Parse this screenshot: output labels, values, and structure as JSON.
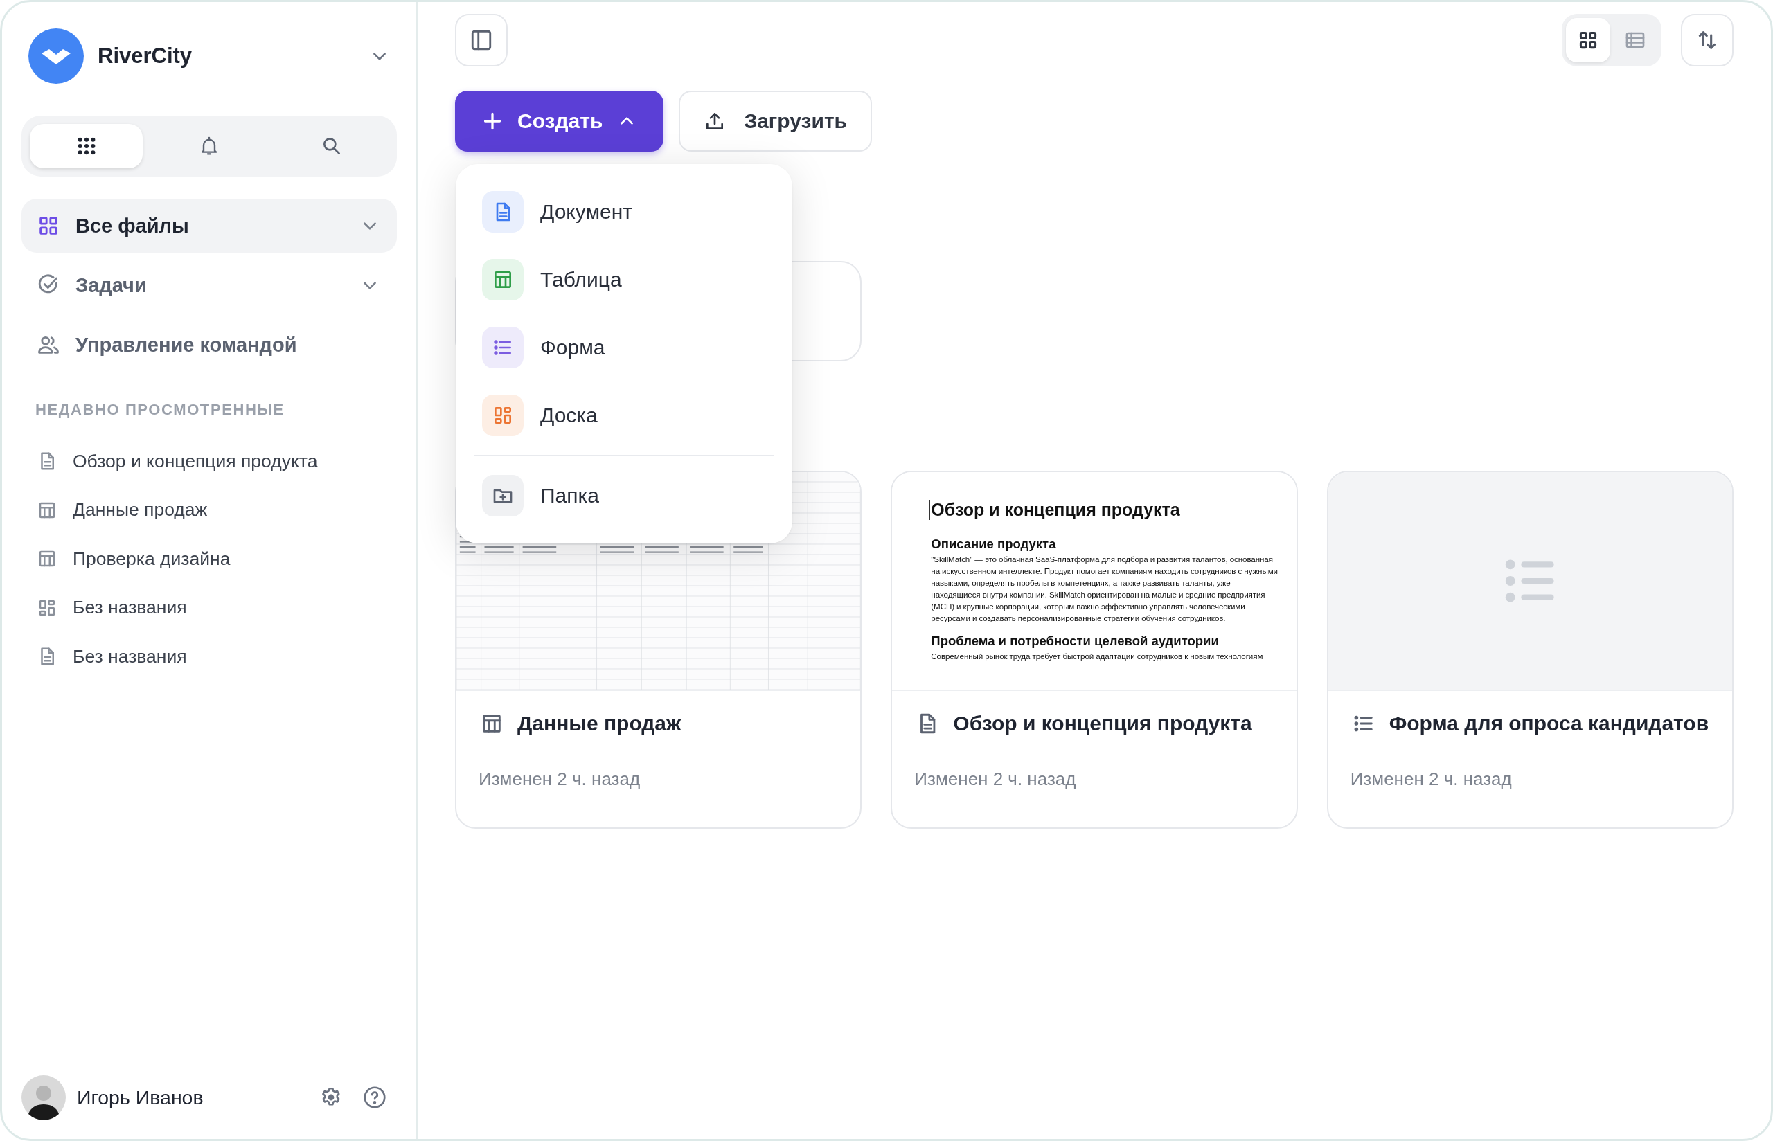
{
  "workspace": {
    "name": "RiverCity"
  },
  "sidebar_tabs": [
    {
      "kind": "apps",
      "selected": true
    },
    {
      "kind": "notifications",
      "selected": false
    },
    {
      "kind": "search",
      "selected": false
    }
  ],
  "nav": [
    {
      "label": "Все файлы",
      "kind": "files",
      "selected": true,
      "expandable": true
    },
    {
      "label": "Задачи",
      "kind": "tasks",
      "selected": false,
      "expandable": true
    },
    {
      "label": "Управление командой",
      "kind": "team",
      "selected": false,
      "expandable": false
    }
  ],
  "recent": {
    "title": "НЕДАВНО ПРОСМОТРЕННЫЕ",
    "items": [
      {
        "label": "Обзор и концепция продукта",
        "kind": "document"
      },
      {
        "label": "Данные продаж",
        "kind": "table"
      },
      {
        "label": "Проверка дизайна",
        "kind": "table"
      },
      {
        "label": "Без названия",
        "kind": "board"
      },
      {
        "label": "Без названия",
        "kind": "document"
      }
    ]
  },
  "user": {
    "name": "Игорь Иванов"
  },
  "views": [
    {
      "kind": "grid",
      "selected": true
    },
    {
      "kind": "list",
      "selected": false
    }
  ],
  "create_button": {
    "label": "Создать",
    "expanded": true
  },
  "upload_button": {
    "label": "Загрузить"
  },
  "create_menu": [
    {
      "label": "Документ",
      "kind": "document"
    },
    {
      "label": "Таблица",
      "kind": "table"
    },
    {
      "label": "Форма",
      "kind": "form"
    },
    {
      "label": "Доска",
      "kind": "board"
    },
    {
      "label": "Папка",
      "kind": "folder"
    }
  ],
  "files": [
    {
      "title": "Данные продаж",
      "kind": "table",
      "modified": "Изменен 2 ч. назад"
    },
    {
      "title": "Обзор и концепция продукта",
      "kind": "document",
      "modified": "Изменен 2 ч. назад",
      "preview": {
        "heading": "Обзор и концепция продукта",
        "sections": [
          {
            "title": "Описание продукта",
            "body": "\"SkillMatch\" — это облачная SaaS-платформа для подбора и развития талантов, основанная на искусственном интеллекте. Продукт помогает компаниям находить сотрудников с нужными навыками, определять пробелы в компетенциях, а также развивать таланты, уже находящиеся внутри компании. SkillMatch ориентирован на малые и средние предприятия (МСП) и крупные корпорации, которым важно эффективно управлять человеческими ресурсами и создавать персонализированные стратегии обучения сотрудников."
          },
          {
            "title": "Проблема и потребности целевой аудитории",
            "body": "Современный рынок труда требует быстрой адаптации сотрудников к новым технологиям"
          }
        ]
      }
    },
    {
      "title": "Форма для опроса кандидатов",
      "kind": "form",
      "modified": "Изменен 2 ч. назад"
    }
  ]
}
